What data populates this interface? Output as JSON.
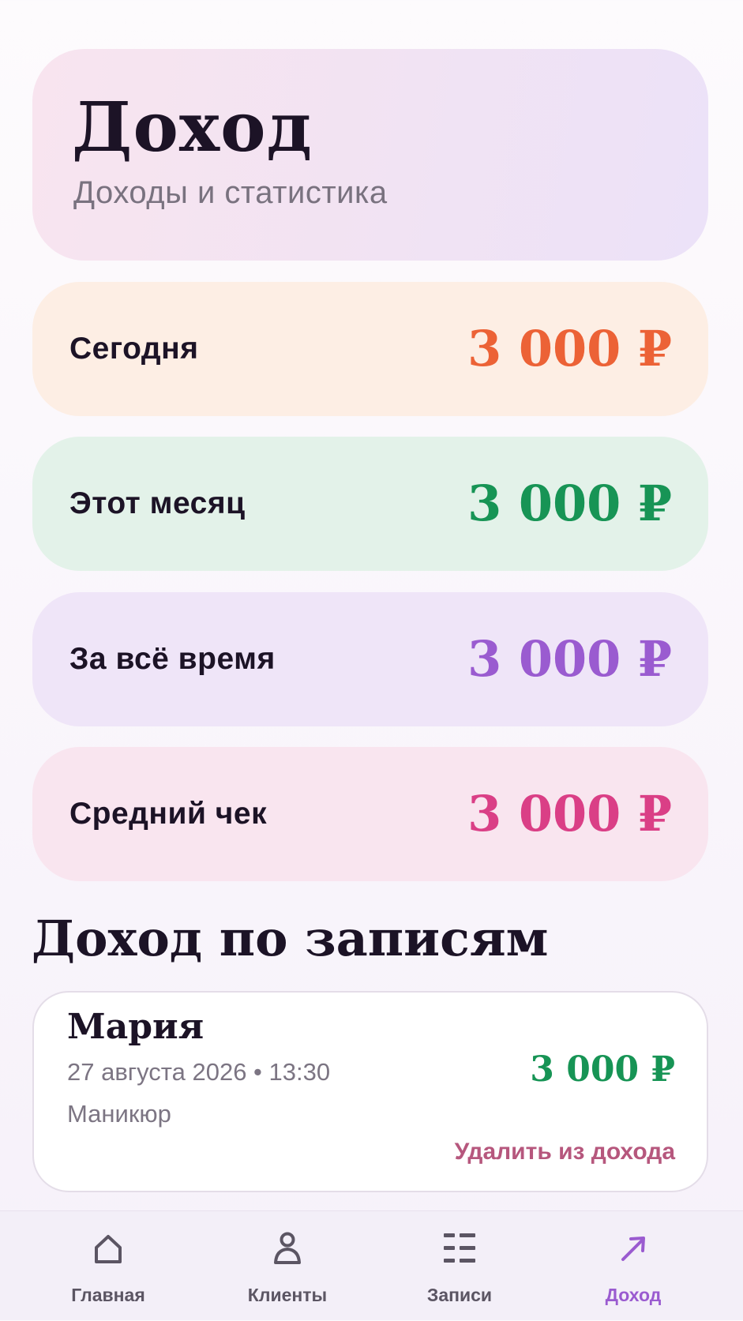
{
  "header": {
    "title": "Доход",
    "subtitle": "Доходы и статистика"
  },
  "stats": [
    {
      "label": "Сегодня",
      "value": "3 000 ₽",
      "color": "#ec6236",
      "background": "#fdeee4"
    },
    {
      "label": "Этот месяц",
      "value": "3 000 ₽",
      "color": "#179455",
      "background": "#e3f2e9"
    },
    {
      "label": "За всё время",
      "value": "3 000 ₽",
      "color": "#9a5bd0",
      "background": "#efe5f8"
    },
    {
      "label": "Средний чек",
      "value": "3 000 ₽",
      "color": "#da3f86",
      "background": "#f9e5ef"
    }
  ],
  "records_section": {
    "title": "Доход по записям",
    "items": [
      {
        "name": "Мария",
        "datetime": "27 августа 2026 • 13:30",
        "service": "Маникюр",
        "amount": "3 000 ₽",
        "delete_label": "Удалить из дохода"
      }
    ]
  },
  "nav": {
    "items": [
      {
        "label": "Главная",
        "icon": "home-icon",
        "active": false
      },
      {
        "label": "Клиенты",
        "icon": "person-icon",
        "active": false
      },
      {
        "label": "Записи",
        "icon": "list-icon",
        "active": false
      },
      {
        "label": "Доход",
        "icon": "trend-arrow-icon",
        "active": true
      }
    ],
    "active_color": "#9a5bd0",
    "inactive_color": "#5b5563"
  }
}
